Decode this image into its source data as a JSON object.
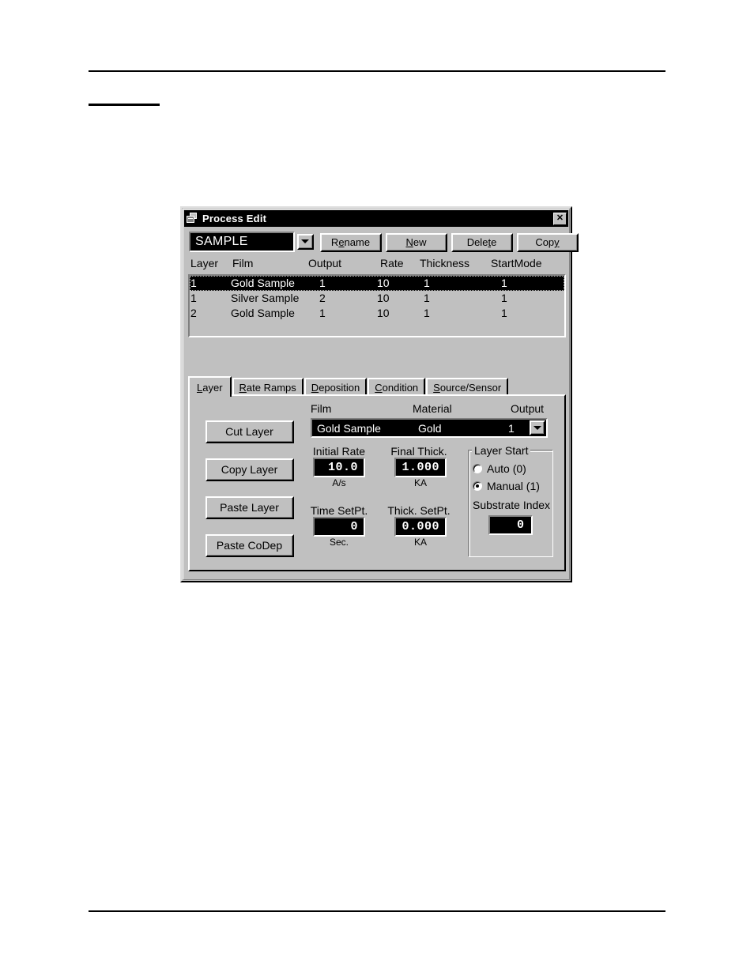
{
  "document": {
    "rules": [
      "top-full-width-rule",
      "short-heading-underline",
      "bottom-full-width-rule"
    ]
  },
  "dialog": {
    "title": "Process Edit",
    "title_icon": "process-sheets-icon",
    "close_label": "✕",
    "close_icon": "close-icon",
    "process_combo": {
      "value": "SAMPLE",
      "arrow_icon": "chevron-down-icon"
    },
    "buttons": [
      {
        "id": "rename",
        "pre": "R",
        "mnemonic": "e",
        "post": "name"
      },
      {
        "id": "new",
        "pre": "",
        "mnemonic": "N",
        "post": "ew"
      },
      {
        "id": "delete",
        "pre": "Dele",
        "mnemonic": "t",
        "post": "e"
      },
      {
        "id": "copy",
        "pre": "Cop",
        "mnemonic": "y",
        "post": ""
      }
    ],
    "layer_list": {
      "headers": [
        "Layer",
        "Film",
        "Output",
        "Rate",
        "Thickness",
        "StartMode"
      ],
      "rows": [
        {
          "layer": "1",
          "film": "Gold Sample",
          "output": "1",
          "rate": "10",
          "thickness": "1",
          "startmode": "1",
          "selected": true
        },
        {
          "layer": "1",
          "film": "Silver Sample",
          "output": "2",
          "rate": "10",
          "thickness": "1",
          "startmode": "1",
          "selected": false
        },
        {
          "layer": "2",
          "film": "Gold Sample",
          "output": "1",
          "rate": "10",
          "thickness": "1",
          "startmode": "1",
          "selected": false
        }
      ]
    },
    "tabs": [
      {
        "id": "layer",
        "pre": "",
        "mnemonic": "L",
        "post": "ayer",
        "active": true
      },
      {
        "id": "rate-ramps",
        "pre": "",
        "mnemonic": "R",
        "post": "ate Ramps",
        "active": false
      },
      {
        "id": "deposition",
        "pre": "",
        "mnemonic": "D",
        "post": "eposition",
        "active": false
      },
      {
        "id": "condition",
        "pre": "",
        "mnemonic": "C",
        "post": "ondition",
        "active": false
      },
      {
        "id": "source-sensor",
        "pre": "",
        "mnemonic": "S",
        "post": "ource/Sensor",
        "active": false
      }
    ],
    "layer_tab": {
      "side_buttons": {
        "cut_layer": "Cut Layer",
        "copy_layer": "Copy Layer",
        "paste_layer": "Paste Layer",
        "paste_codep": "Paste CoDep"
      },
      "film_row": {
        "label_film": "Film",
        "label_material": "Material",
        "label_output": "Output",
        "film": "Gold Sample",
        "material": "Gold",
        "output": "1",
        "arrow_icon": "chevron-down-icon"
      },
      "initial_rate": {
        "label": "Initial  Rate",
        "value": "10.0",
        "units": "A/s"
      },
      "final_thick": {
        "label": "Final Thick.",
        "value": "1.000",
        "units": "KA"
      },
      "time_setpt": {
        "label": "Time SetPt.",
        "value": "0",
        "units": "Sec."
      },
      "thick_setpt": {
        "label": "Thick. SetPt.",
        "value": "0.000",
        "units": "KA"
      },
      "layer_start": {
        "legend": "Layer Start",
        "options": [
          {
            "label": "Auto (0)",
            "selected": false
          },
          {
            "label": "Manual (1)",
            "selected": true
          }
        ],
        "substrate_index_label": "Substrate Index",
        "substrate_index_value": "0"
      }
    }
  },
  "colors": {
    "face": "#c0c0c0",
    "shadow": "#808080",
    "highlight": "#ffffff",
    "dark": "#000000",
    "field_bg": "#000000",
    "field_fg": "#ffffff"
  }
}
